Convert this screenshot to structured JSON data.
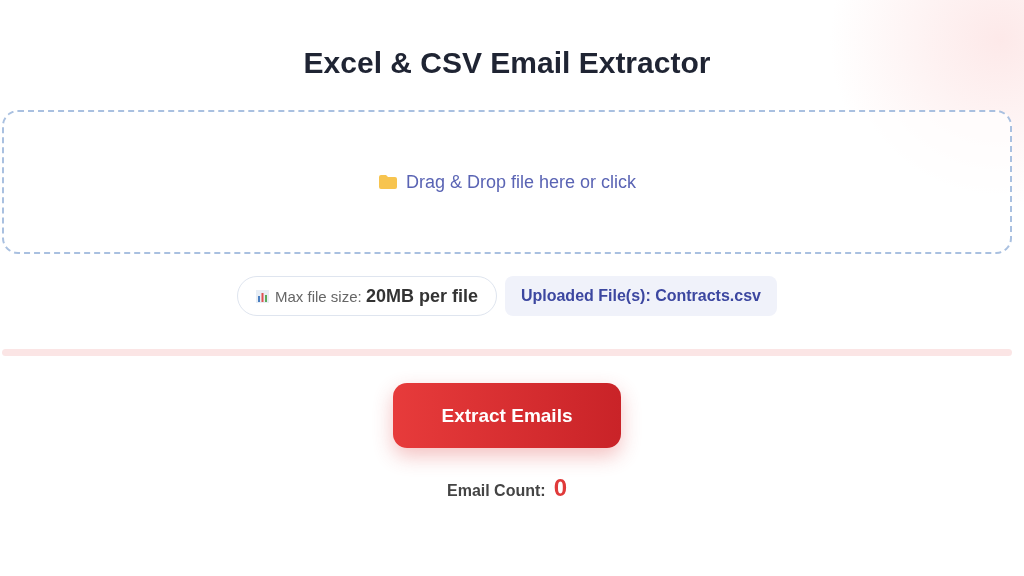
{
  "title": "Excel & CSV Email Extractor",
  "dropzone": {
    "label": "Drag & Drop file here or click"
  },
  "info": {
    "max_size": "Max file size: **20MB per file**",
    "uploaded": "Uploaded File(s): Contracts.csv"
  },
  "progress": {
    "level": 0
  },
  "extract_button": "Extract Emails",
  "email_count": {
    "label": "Email Count:",
    "value": "0"
  }
}
